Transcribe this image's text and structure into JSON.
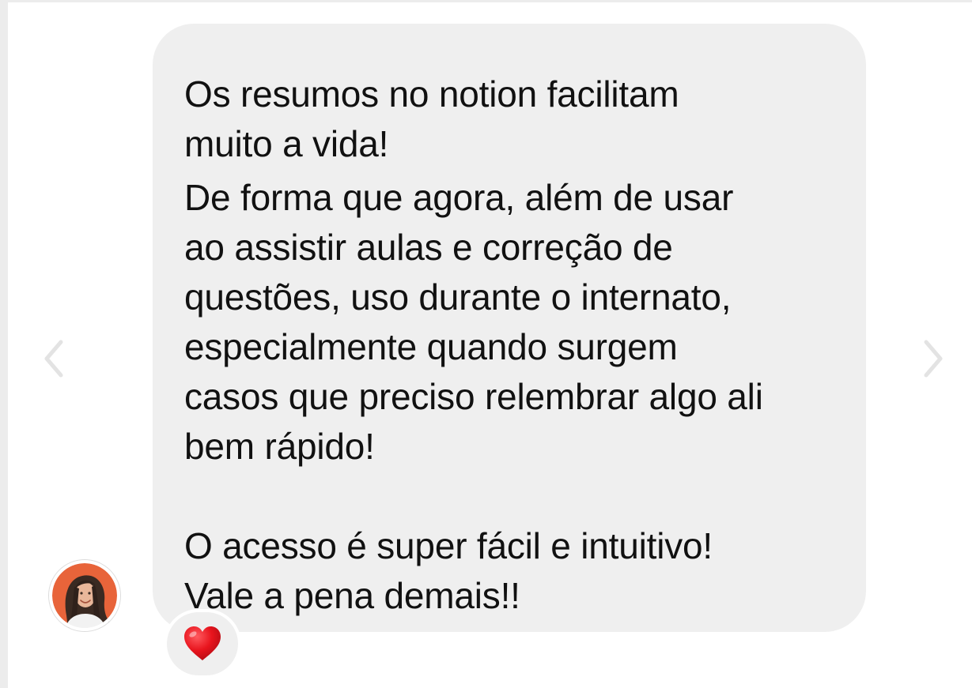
{
  "conversation": {
    "message": {
      "paragraphs": [
        [
          "Os resumos no notion facilitam",
          "muito a vida!"
        ],
        [
          "De forma que agora, além de usar",
          "ao assistir aulas e correção de",
          "questões, uso durante o internato,",
          "especialmente quando surgem",
          "casos que preciso relembrar algo ali",
          "bem rápido!"
        ],
        [
          "O acesso é super fácil e intuitivo!",
          "Vale a pena demais!!"
        ]
      ],
      "reaction": "heart-emoji-icon"
    },
    "navigation": {
      "prev_icon": "chevron-left-icon",
      "next_icon": "chevron-right-icon"
    },
    "colors": {
      "bubble": "#efefef",
      "text": "#111111",
      "arrow": "#e3e3e3",
      "heart": "#e8141d",
      "avatar_bg": "#e8643a"
    }
  }
}
